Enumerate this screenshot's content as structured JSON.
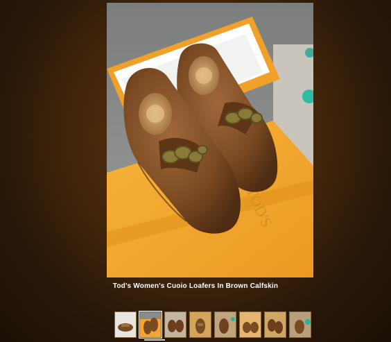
{
  "gallery": {
    "caption": "Tod's Women's Cuoio Loafers In Brown Calfskin",
    "main_image_icon": "loafers-photo",
    "thumbnails": [
      {
        "icon": "shoe-thumbnail"
      },
      {
        "icon": "shoe-thumbnail"
      },
      {
        "icon": "shoe-thumbnail"
      },
      {
        "icon": "shoe-thumbnail"
      },
      {
        "icon": "shoe-thumbnail"
      },
      {
        "icon": "shoe-thumbnail"
      },
      {
        "icon": "shoe-thumbnail"
      },
      {
        "icon": "shoe-thumbnail"
      }
    ],
    "selected_index": 1
  },
  "colors": {
    "background": "#2a1808",
    "box_orange": "#f4a532",
    "leather_brown": "#7a4a22",
    "caption_text": "#ffffff"
  }
}
